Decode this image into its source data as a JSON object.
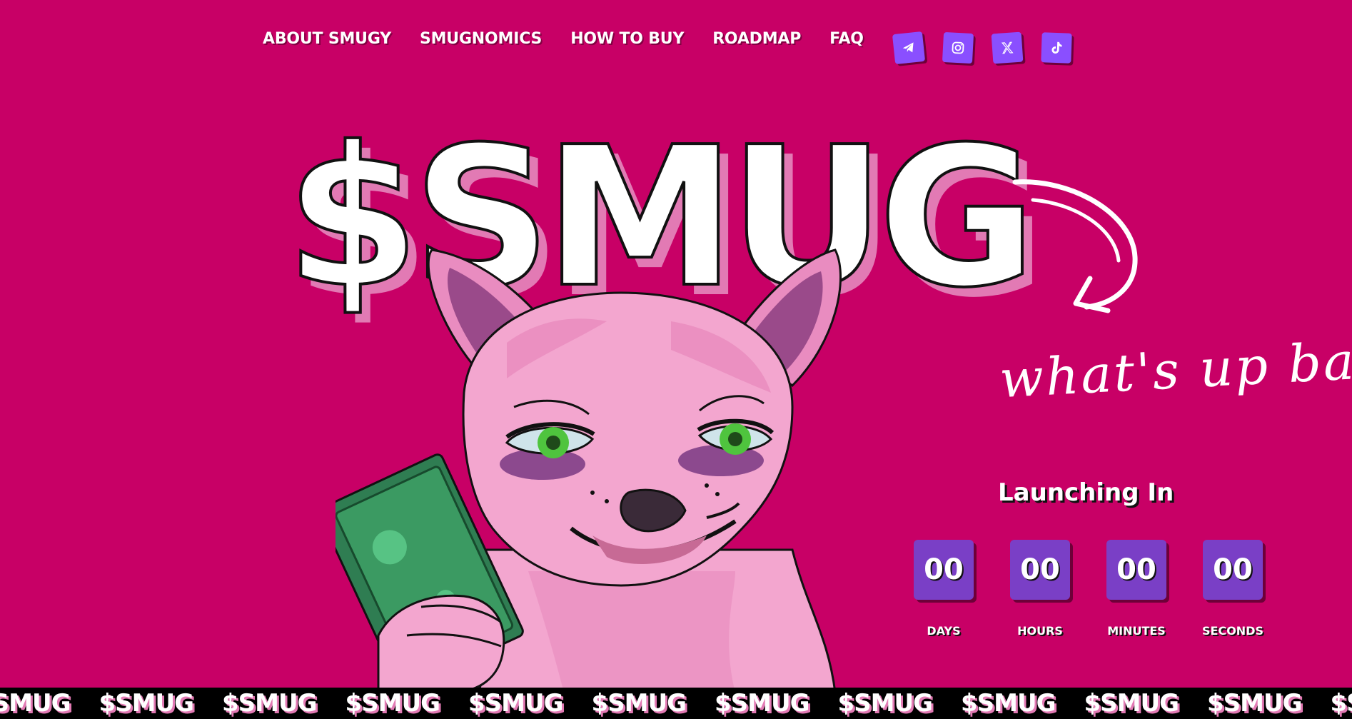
{
  "nav": {
    "items": [
      {
        "label": "ABOUT SMUGY"
      },
      {
        "label": "SMUGNOMICS"
      },
      {
        "label": "HOW TO BUY"
      },
      {
        "label": "ROADMAP"
      },
      {
        "label": "FAQ"
      }
    ]
  },
  "socials": [
    {
      "icon": "telegram-icon"
    },
    {
      "icon": "instagram-icon"
    },
    {
      "icon": "x-icon"
    },
    {
      "icon": "tiktok-icon"
    }
  ],
  "hero": {
    "title": "$SMUG",
    "tagline": "what's up bae"
  },
  "countdown": {
    "heading": "Launching In",
    "days_value": "00",
    "days_label": "DAYS",
    "hours_value": "00",
    "hours_label": "HOURS",
    "minutes_value": "00",
    "minutes_label": "MINUTES",
    "seconds_value": "00",
    "seconds_label": "SECONDS"
  },
  "ticker": {
    "item": "$SMUG"
  },
  "colors": {
    "background": "#c80066",
    "accent": "#8a4fff",
    "countdown_box": "#7a3fc6",
    "shadow_pink": "#e27ab4"
  }
}
